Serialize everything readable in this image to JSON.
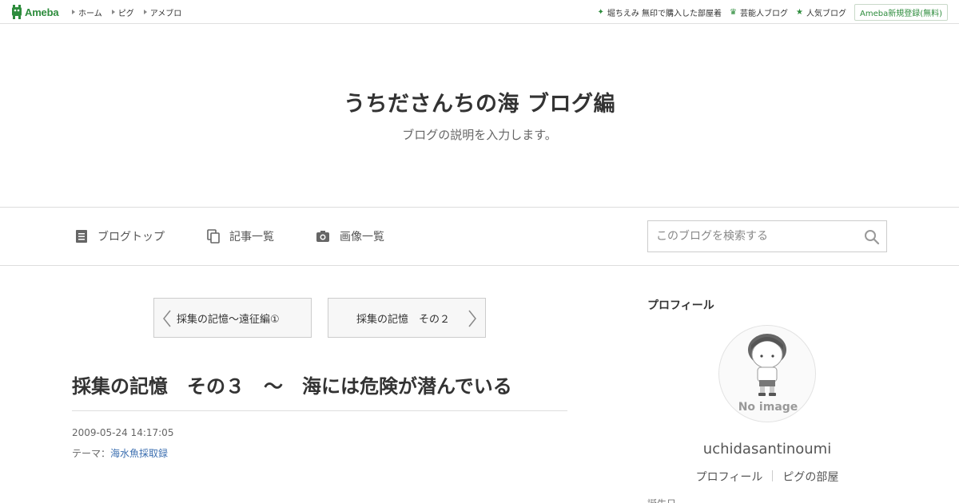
{
  "topbar": {
    "logo_text": "Ameba",
    "nav": [
      "ホーム",
      "ピグ",
      "アメブロ"
    ],
    "right_items": [
      {
        "icon": "sparkle-icon",
        "label": "堀ちえみ 無印で購入した部屋着"
      },
      {
        "icon": "crown-icon",
        "label": "芸能人ブログ"
      },
      {
        "icon": "star-icon",
        "label": "人気ブログ"
      }
    ],
    "signup_label": "Ameba新規登録(無料)"
  },
  "header": {
    "title": "うちださんちの海 ブログ編",
    "description": "ブログの説明を入力します。"
  },
  "nav": {
    "items": [
      {
        "icon": "document-icon",
        "label": "ブログトップ"
      },
      {
        "icon": "copy-icon",
        "label": "記事一覧"
      },
      {
        "icon": "camera-icon",
        "label": "画像一覧"
      }
    ],
    "search_placeholder": "このブログを検索する"
  },
  "pager": {
    "prev_label": "採集の記憶～遠征編①",
    "next_label": "採集の記憶　その２"
  },
  "article": {
    "title": "採集の記憶　その３　～　海には危険が潜んでいる",
    "date": "2009-05-24 14:17:05",
    "theme_prefix": "テーマ：",
    "theme": "海水魚採取録"
  },
  "sidebar": {
    "heading": "プロフィール",
    "avatar_text": "No image",
    "username": "uchidasantinoumi",
    "links": [
      "プロフィール",
      "ピグの部屋"
    ],
    "cut_text": "誕生日"
  },
  "colors": {
    "brand": "#2d8c3c",
    "link": "#3c6fb0",
    "border": "#dddddd"
  }
}
